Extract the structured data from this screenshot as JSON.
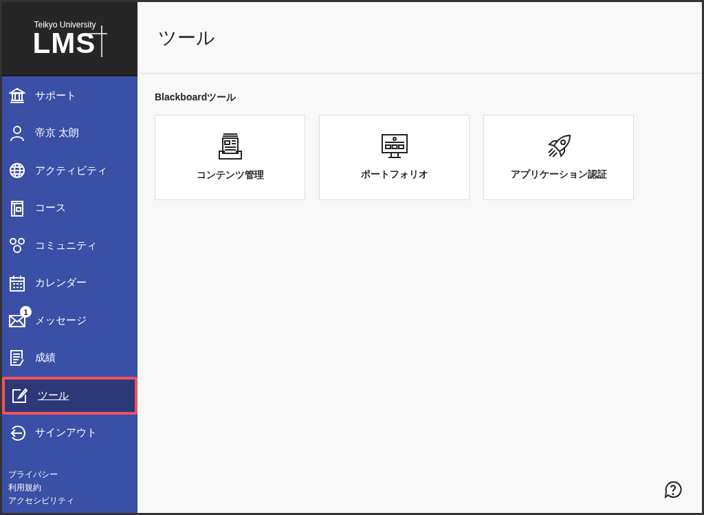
{
  "logo": {
    "subtitle": "Teikyo University",
    "title": "LMS"
  },
  "sidebar": {
    "items": [
      {
        "label": "サポート",
        "selected": false
      },
      {
        "label": "帝京 太朗",
        "selected": false
      },
      {
        "label": "アクティビティ",
        "selected": false
      },
      {
        "label": "コース",
        "selected": false
      },
      {
        "label": "コミュニティ",
        "selected": false
      },
      {
        "label": "カレンダー",
        "selected": false
      },
      {
        "label": "メッセージ",
        "selected": false,
        "badge": "1"
      },
      {
        "label": "成績",
        "selected": false
      },
      {
        "label": "ツール",
        "selected": true
      },
      {
        "label": "サインアウト",
        "selected": false
      }
    ],
    "footer_links": [
      "プライバシー",
      "利用規約",
      "アクセシビリティ"
    ]
  },
  "page": {
    "title": "ツール",
    "section_title": "Blackboardツール",
    "tools": [
      {
        "label": "コンテンツ管理"
      },
      {
        "label": "ポートフォリオ"
      },
      {
        "label": "アプリケーション認証"
      }
    ]
  }
}
